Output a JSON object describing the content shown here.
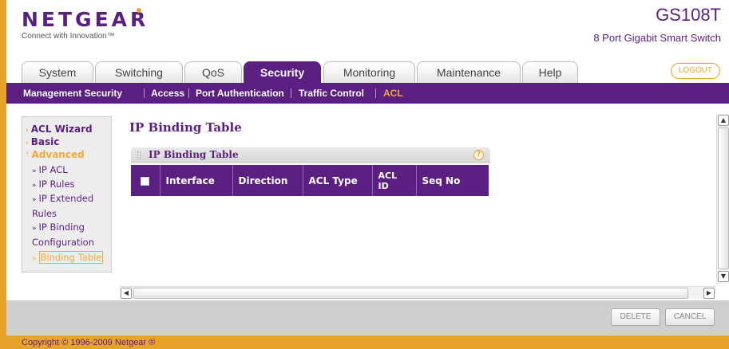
{
  "header": {
    "logo": "NETGEAR",
    "tagline": "Connect with Innovation™",
    "model": "GS108T",
    "model_desc": "8 Port Gigabit Smart Switch"
  },
  "tabs": [
    {
      "label": "System"
    },
    {
      "label": "Switching"
    },
    {
      "label": "QoS"
    },
    {
      "label": "Security",
      "active": true
    },
    {
      "label": "Monitoring"
    },
    {
      "label": "Maintenance"
    },
    {
      "label": "Help"
    }
  ],
  "logout_label": "LOGOUT",
  "subnav": [
    {
      "label": "Management Security"
    },
    {
      "label": "Access"
    },
    {
      "label": "Port Authentication"
    },
    {
      "label": "Traffic Control"
    },
    {
      "label": "ACL",
      "active": true
    }
  ],
  "sidenav": {
    "acl_wizard": "ACL Wizard",
    "basic": "Basic",
    "advanced": "Advanced",
    "items": [
      {
        "label": "IP ACL"
      },
      {
        "label": "IP Rules"
      },
      {
        "label": "IP Extended Rules"
      },
      {
        "label": "IP Binding Configuration"
      },
      {
        "label": "Binding Table",
        "active": true
      }
    ]
  },
  "page_title": "IP Binding Table",
  "panel": {
    "title": "IP Binding Table",
    "help": "?",
    "columns": [
      "Interface",
      "Direction",
      "ACL Type",
      "ACL ID",
      "Seq No"
    ]
  },
  "buttons": {
    "delete": "DELETE",
    "cancel": "CANCEL"
  },
  "copyright": "Copyright © 1996-2009 Netgear ®",
  "colors": {
    "brand_purple": "#5b1f82",
    "accent_orange": "#e8a32a"
  }
}
